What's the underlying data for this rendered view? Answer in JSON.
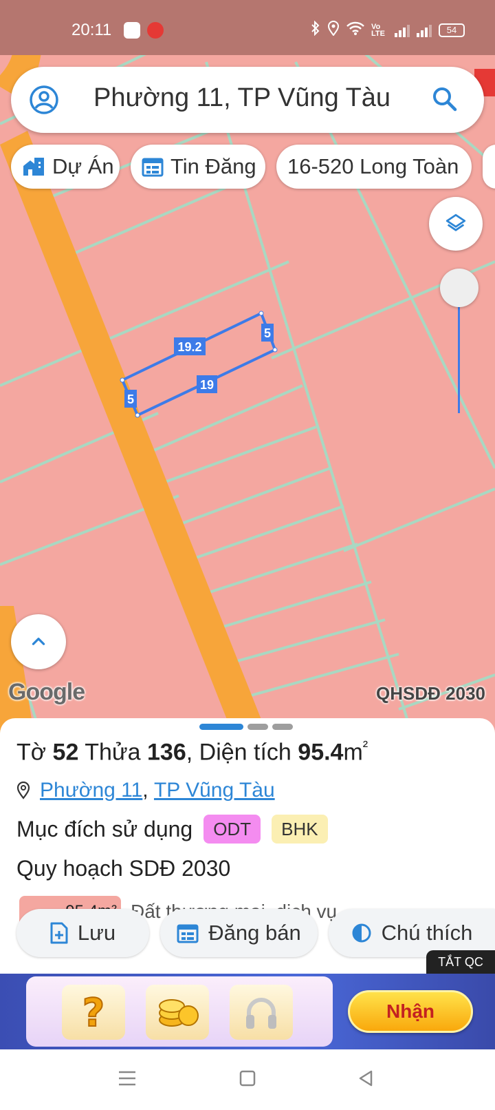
{
  "status_bar": {
    "time": "20:11",
    "battery": "54",
    "network": "Vo LTE"
  },
  "search": {
    "text": "Phường 11, TP Vũng Tàu"
  },
  "chips": [
    {
      "label": "Dự Án",
      "icon": "home-city-icon"
    },
    {
      "label": "Tin Đăng",
      "icon": "calendar-list-icon"
    },
    {
      "label": "16-520 Long Toàn",
      "icon": ""
    }
  ],
  "map": {
    "parcel_edges": {
      "top": "19.2",
      "right": "5",
      "bottom": "19",
      "left": "5"
    },
    "google_logo": "Google",
    "layer_label": "QHSDĐ 2030",
    "opacity_level": 1.0,
    "colors": {
      "land": "#f4a7a0",
      "road": "#f7a53a",
      "lot_lines": "#a9d8c2",
      "parcel_outline": "#3d7be8"
    }
  },
  "sheet": {
    "title": {
      "sheet_label": "Tờ",
      "sheet_no": "52",
      "lot_label": "Thửa",
      "lot_no": "136",
      "area_label": ", Diện tích",
      "area": "95.4",
      "unit": "m",
      "unit_sup": "²"
    },
    "location": {
      "ward": "Phường 11",
      "sep": ", ",
      "city": "TP Vũng Tàu"
    },
    "usage": {
      "label": "Mục đích sử dụng",
      "tags": [
        {
          "text": "ODT",
          "color": "#f48cf0"
        },
        {
          "text": "BHK",
          "color": "#fbefb3"
        }
      ]
    },
    "plan_label": "Quy hoạch SDĐ 2030",
    "area_legend": {
      "value": "95.4m²",
      "description": "Đất thương mại, dịch vụ"
    },
    "actions": [
      {
        "label": "Lưu",
        "icon": "file-plus-icon"
      },
      {
        "label": "Đăng bán",
        "icon": "calendar-list-icon"
      },
      {
        "label": "Chú thích",
        "icon": "contrast-icon"
      }
    ]
  },
  "ad": {
    "close_label": "TẮT QC",
    "claim_label": "Nhận"
  }
}
